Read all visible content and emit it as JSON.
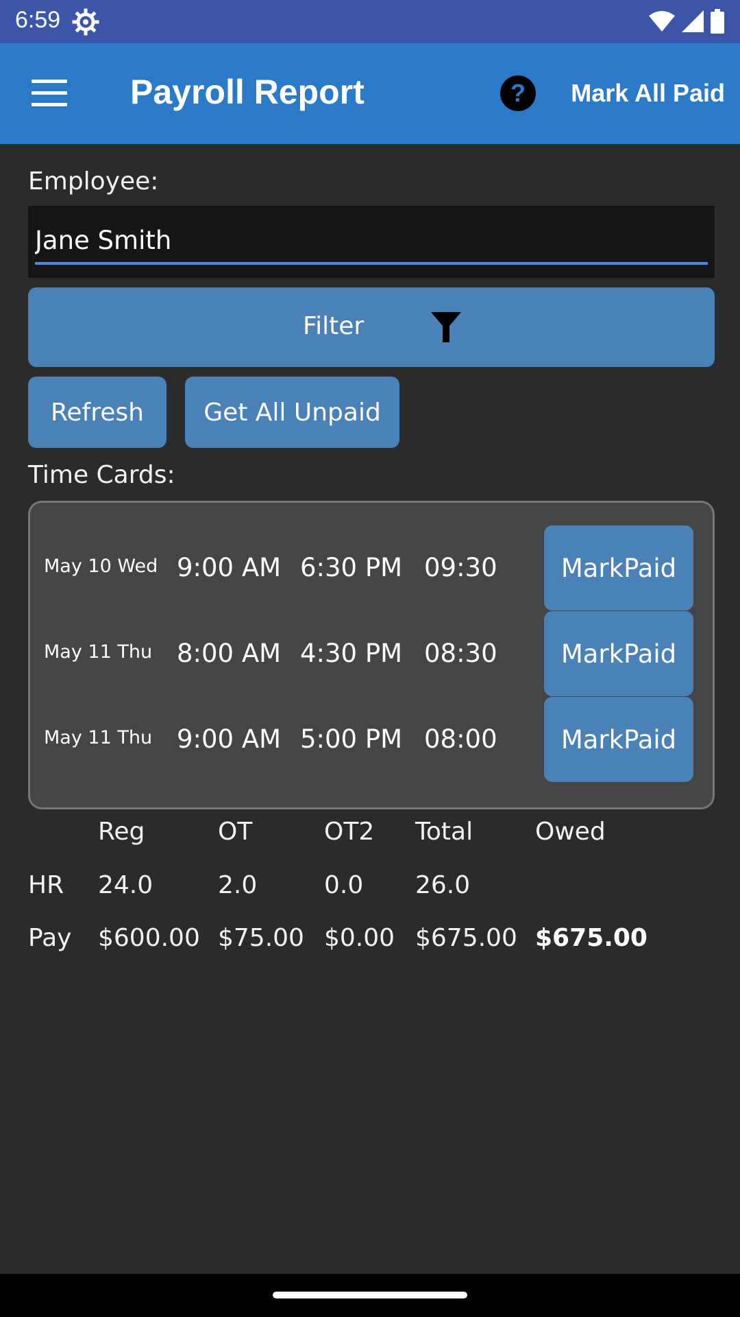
{
  "status_bar": {
    "time": "6:59",
    "icons": [
      "settings-gear-icon",
      "wifi-icon",
      "signal-icon",
      "battery-icon"
    ]
  },
  "app_bar": {
    "title": "Payroll Report",
    "menu_icon": "hamburger-menu-icon",
    "help_icon": "help-circle-icon",
    "action_label": "Mark All Paid",
    "color": "#2a7ac8"
  },
  "employee": {
    "label": "Employee:",
    "value": "Jane Smith",
    "placeholder": ""
  },
  "buttons": {
    "filter_label": "Filter",
    "filter_icon": "funnel-icon",
    "refresh_label": "Refresh",
    "get_unpaid_label": "Get All Unpaid",
    "color": "#4a82b8"
  },
  "time_cards": {
    "label": "Time Cards:",
    "rows": [
      {
        "date": "May 10 Wed",
        "time_in": "9:00 AM",
        "time_out": "6:30 PM",
        "hours": "09:30",
        "action": "MarkPaid"
      },
      {
        "date": "May 11 Thu",
        "time_in": "8:00 AM",
        "time_out": "4:30 PM",
        "hours": "08:30",
        "action": "MarkPaid"
      },
      {
        "date": "May 11 Thu",
        "time_in": "9:00 AM",
        "time_out": "5:00 PM",
        "hours": "08:00",
        "action": "MarkPaid"
      }
    ]
  },
  "summary": {
    "headers": [
      "Reg",
      "OT",
      "OT2",
      "Total",
      "Owed"
    ],
    "hr": {
      "label": "HR",
      "reg": "24.0",
      "ot": "2.0",
      "ot2": "0.0",
      "total": "26.0"
    },
    "pay": {
      "label": "Pay",
      "reg": "$600.00",
      "ot": "$75.00",
      "ot2": "$0.00",
      "total": "$675.00",
      "owed": "$675.00"
    }
  }
}
